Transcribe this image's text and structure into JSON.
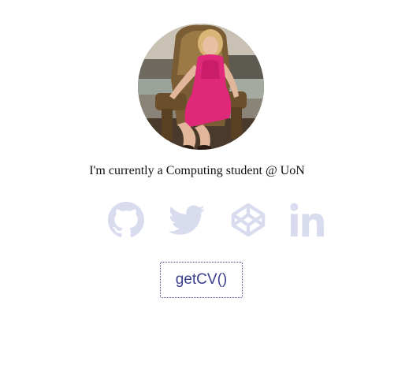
{
  "profile": {
    "tagline": "I'm currently a Computing student @ UoN"
  },
  "socials": {
    "icon_color": "#d9dbee",
    "items": [
      {
        "icon": "github-icon"
      },
      {
        "icon": "twitter-icon"
      },
      {
        "icon": "codepen-icon"
      },
      {
        "icon": "linkedin-icon"
      }
    ]
  },
  "cv_button": {
    "label": "getCV()",
    "color": "#3a3f8f"
  }
}
